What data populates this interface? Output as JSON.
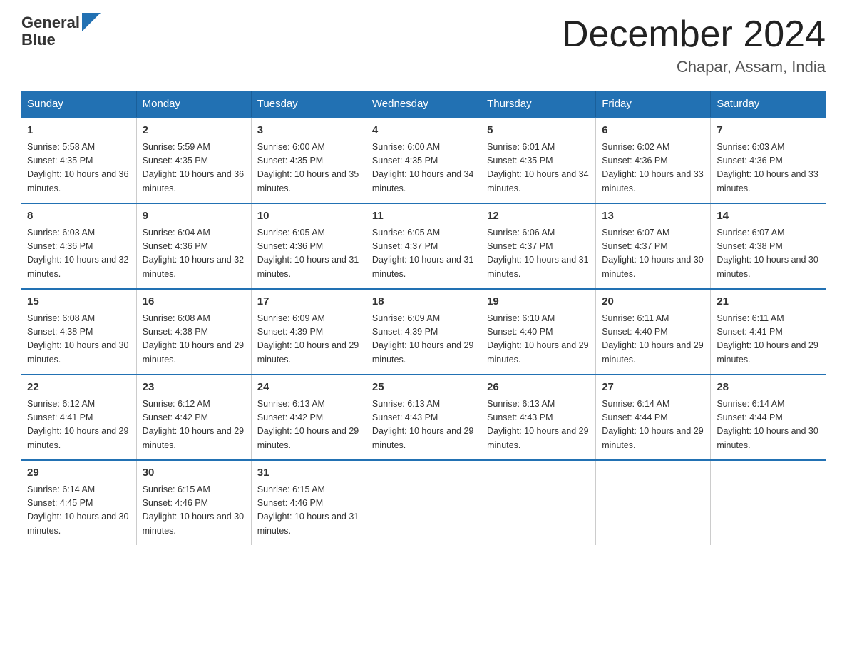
{
  "header": {
    "logo_line1": "General",
    "logo_line2": "Blue",
    "month_title": "December 2024",
    "location": "Chapar, Assam, India"
  },
  "weekdays": [
    "Sunday",
    "Monday",
    "Tuesday",
    "Wednesday",
    "Thursday",
    "Friday",
    "Saturday"
  ],
  "weeks": [
    [
      {
        "day": 1,
        "sunrise": "5:58 AM",
        "sunset": "4:35 PM",
        "daylight": "10 hours and 36 minutes."
      },
      {
        "day": 2,
        "sunrise": "5:59 AM",
        "sunset": "4:35 PM",
        "daylight": "10 hours and 36 minutes."
      },
      {
        "day": 3,
        "sunrise": "6:00 AM",
        "sunset": "4:35 PM",
        "daylight": "10 hours and 35 minutes."
      },
      {
        "day": 4,
        "sunrise": "6:00 AM",
        "sunset": "4:35 PM",
        "daylight": "10 hours and 34 minutes."
      },
      {
        "day": 5,
        "sunrise": "6:01 AM",
        "sunset": "4:35 PM",
        "daylight": "10 hours and 34 minutes."
      },
      {
        "day": 6,
        "sunrise": "6:02 AM",
        "sunset": "4:36 PM",
        "daylight": "10 hours and 33 minutes."
      },
      {
        "day": 7,
        "sunrise": "6:03 AM",
        "sunset": "4:36 PM",
        "daylight": "10 hours and 33 minutes."
      }
    ],
    [
      {
        "day": 8,
        "sunrise": "6:03 AM",
        "sunset": "4:36 PM",
        "daylight": "10 hours and 32 minutes."
      },
      {
        "day": 9,
        "sunrise": "6:04 AM",
        "sunset": "4:36 PM",
        "daylight": "10 hours and 32 minutes."
      },
      {
        "day": 10,
        "sunrise": "6:05 AM",
        "sunset": "4:36 PM",
        "daylight": "10 hours and 31 minutes."
      },
      {
        "day": 11,
        "sunrise": "6:05 AM",
        "sunset": "4:37 PM",
        "daylight": "10 hours and 31 minutes."
      },
      {
        "day": 12,
        "sunrise": "6:06 AM",
        "sunset": "4:37 PM",
        "daylight": "10 hours and 31 minutes."
      },
      {
        "day": 13,
        "sunrise": "6:07 AM",
        "sunset": "4:37 PM",
        "daylight": "10 hours and 30 minutes."
      },
      {
        "day": 14,
        "sunrise": "6:07 AM",
        "sunset": "4:38 PM",
        "daylight": "10 hours and 30 minutes."
      }
    ],
    [
      {
        "day": 15,
        "sunrise": "6:08 AM",
        "sunset": "4:38 PM",
        "daylight": "10 hours and 30 minutes."
      },
      {
        "day": 16,
        "sunrise": "6:08 AM",
        "sunset": "4:38 PM",
        "daylight": "10 hours and 29 minutes."
      },
      {
        "day": 17,
        "sunrise": "6:09 AM",
        "sunset": "4:39 PM",
        "daylight": "10 hours and 29 minutes."
      },
      {
        "day": 18,
        "sunrise": "6:09 AM",
        "sunset": "4:39 PM",
        "daylight": "10 hours and 29 minutes."
      },
      {
        "day": 19,
        "sunrise": "6:10 AM",
        "sunset": "4:40 PM",
        "daylight": "10 hours and 29 minutes."
      },
      {
        "day": 20,
        "sunrise": "6:11 AM",
        "sunset": "4:40 PM",
        "daylight": "10 hours and 29 minutes."
      },
      {
        "day": 21,
        "sunrise": "6:11 AM",
        "sunset": "4:41 PM",
        "daylight": "10 hours and 29 minutes."
      }
    ],
    [
      {
        "day": 22,
        "sunrise": "6:12 AM",
        "sunset": "4:41 PM",
        "daylight": "10 hours and 29 minutes."
      },
      {
        "day": 23,
        "sunrise": "6:12 AM",
        "sunset": "4:42 PM",
        "daylight": "10 hours and 29 minutes."
      },
      {
        "day": 24,
        "sunrise": "6:13 AM",
        "sunset": "4:42 PM",
        "daylight": "10 hours and 29 minutes."
      },
      {
        "day": 25,
        "sunrise": "6:13 AM",
        "sunset": "4:43 PM",
        "daylight": "10 hours and 29 minutes."
      },
      {
        "day": 26,
        "sunrise": "6:13 AM",
        "sunset": "4:43 PM",
        "daylight": "10 hours and 29 minutes."
      },
      {
        "day": 27,
        "sunrise": "6:14 AM",
        "sunset": "4:44 PM",
        "daylight": "10 hours and 29 minutes."
      },
      {
        "day": 28,
        "sunrise": "6:14 AM",
        "sunset": "4:44 PM",
        "daylight": "10 hours and 30 minutes."
      }
    ],
    [
      {
        "day": 29,
        "sunrise": "6:14 AM",
        "sunset": "4:45 PM",
        "daylight": "10 hours and 30 minutes."
      },
      {
        "day": 30,
        "sunrise": "6:15 AM",
        "sunset": "4:46 PM",
        "daylight": "10 hours and 30 minutes."
      },
      {
        "day": 31,
        "sunrise": "6:15 AM",
        "sunset": "4:46 PM",
        "daylight": "10 hours and 31 minutes."
      },
      null,
      null,
      null,
      null
    ]
  ]
}
